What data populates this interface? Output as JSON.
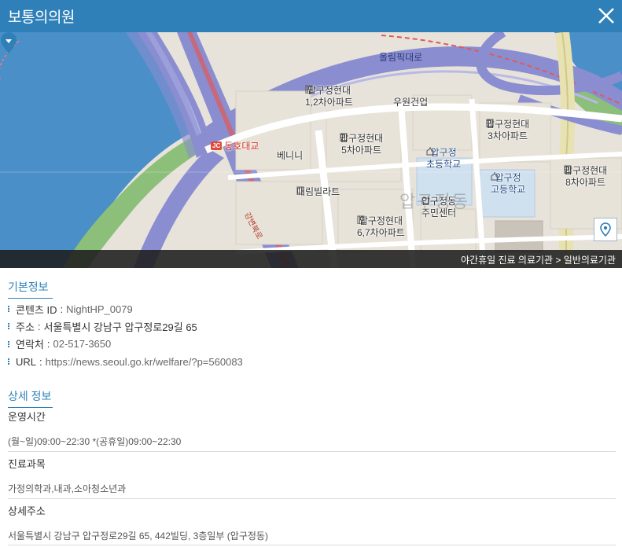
{
  "header": {
    "title": "보통의의원",
    "close_icon": "close-icon"
  },
  "map": {
    "road_olympic": "올림픽대로",
    "road_gangbyeon": "강변북로",
    "jc_badge": "JC",
    "jc_label": "동호대교",
    "area_watermark": "압구정동",
    "labels": {
      "apgujeong_hyundai_12": "압구정현대\n1,2차아파트",
      "uwon": "우원건업",
      "apgujeong_hyundai_3": "압구정현대\n3차아파트",
      "apgujeong_hyundai_5": "압구정현대\n5차아파트",
      "benini": "베니니",
      "apgujeong_elem": "압구정\n초등학교",
      "apgujeong_high": "압구정\n고등학교",
      "apgujeong_hyundai_8": "압구정현대\n8차아파트",
      "daerim_villa": "대림빌라트",
      "community_center": "압구정동\n주민센터",
      "apgujeong_hyundai_67": "압구정현대\n6,7차아파트"
    },
    "pin_icon": "location-pin-icon",
    "locate_icon": "my-location-icon",
    "footer_text": "야간휴일 진료 의료기관 > 일반의료기관"
  },
  "basic_info": {
    "title": "기본정보",
    "items": [
      {
        "label": "콘텐츠 ID",
        "value": "NightHP_0079"
      },
      {
        "label": "주소",
        "value": "서울특별시 강남구 압구정로29길 65"
      },
      {
        "label": "연락처",
        "value": "02-517-3650"
      },
      {
        "label": "URL",
        "value": "https://news.seoul.go.kr/welfare/?p=560083"
      }
    ]
  },
  "detail_info": {
    "title": "상세 정보",
    "blocks": [
      {
        "label": "운영시간",
        "value": "(월~일)09:00~22:30 *(공휴일)09:00~22:30"
      },
      {
        "label": "진료과목",
        "value": "가정의학과,내과,소아청소년과"
      },
      {
        "label": "상세주소",
        "value": "서울특별시 강남구 압구정로29길 65, 442빌딩, 3층일부 (압구정동)"
      }
    ]
  },
  "colors": {
    "header_bg": "#2f80b9",
    "accent": "#2f80b9",
    "water": "#4a8fc7",
    "highway": "#8a8ed0"
  }
}
